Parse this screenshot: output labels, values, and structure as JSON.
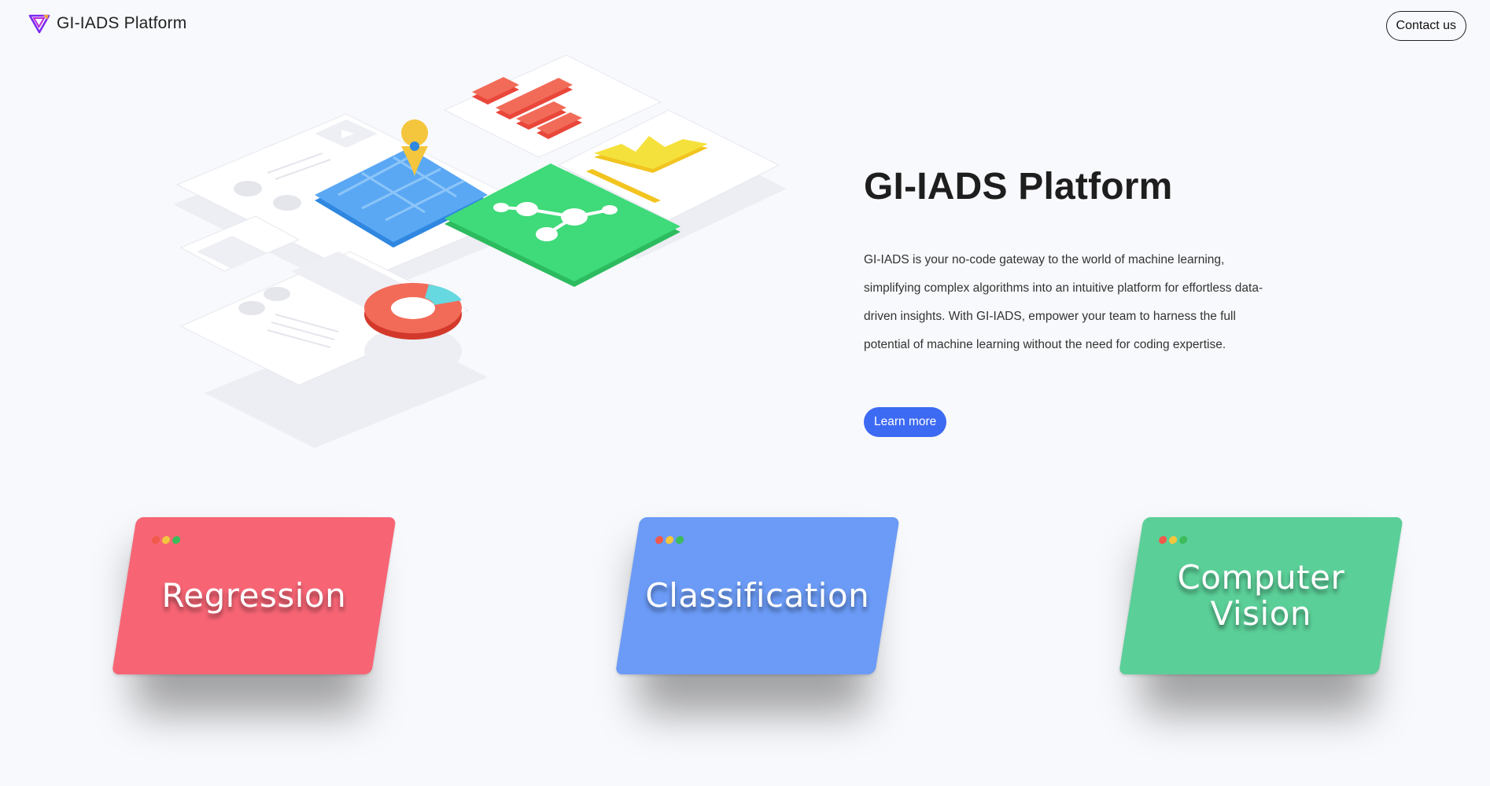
{
  "header": {
    "brand_name": "GI-IADS Platform",
    "contact_label": "Contact us"
  },
  "hero": {
    "title": "GI-IADS Platform",
    "description": "GI-IADS is your no-code gateway to the world of machine learning, simplifying complex algorithms into an intuitive platform for effortless data-driven insights. With GI-IADS, empower your team to harness the full potential of machine learning without the need for coding expertise.",
    "learn_more_label": "Learn more"
  },
  "cards": [
    {
      "label": "Regression",
      "color": "#f76575"
    },
    {
      "label": "Classification",
      "color": "#6b9bf6"
    },
    {
      "label": "Computer Vision",
      "color": "#5bcf98"
    }
  ],
  "colors": {
    "accent": "#3d6af2",
    "background": "#f8f9fc",
    "dot_red": "#ef5a4a",
    "dot_yellow": "#f4c63d",
    "dot_green": "#3dbb5b"
  }
}
